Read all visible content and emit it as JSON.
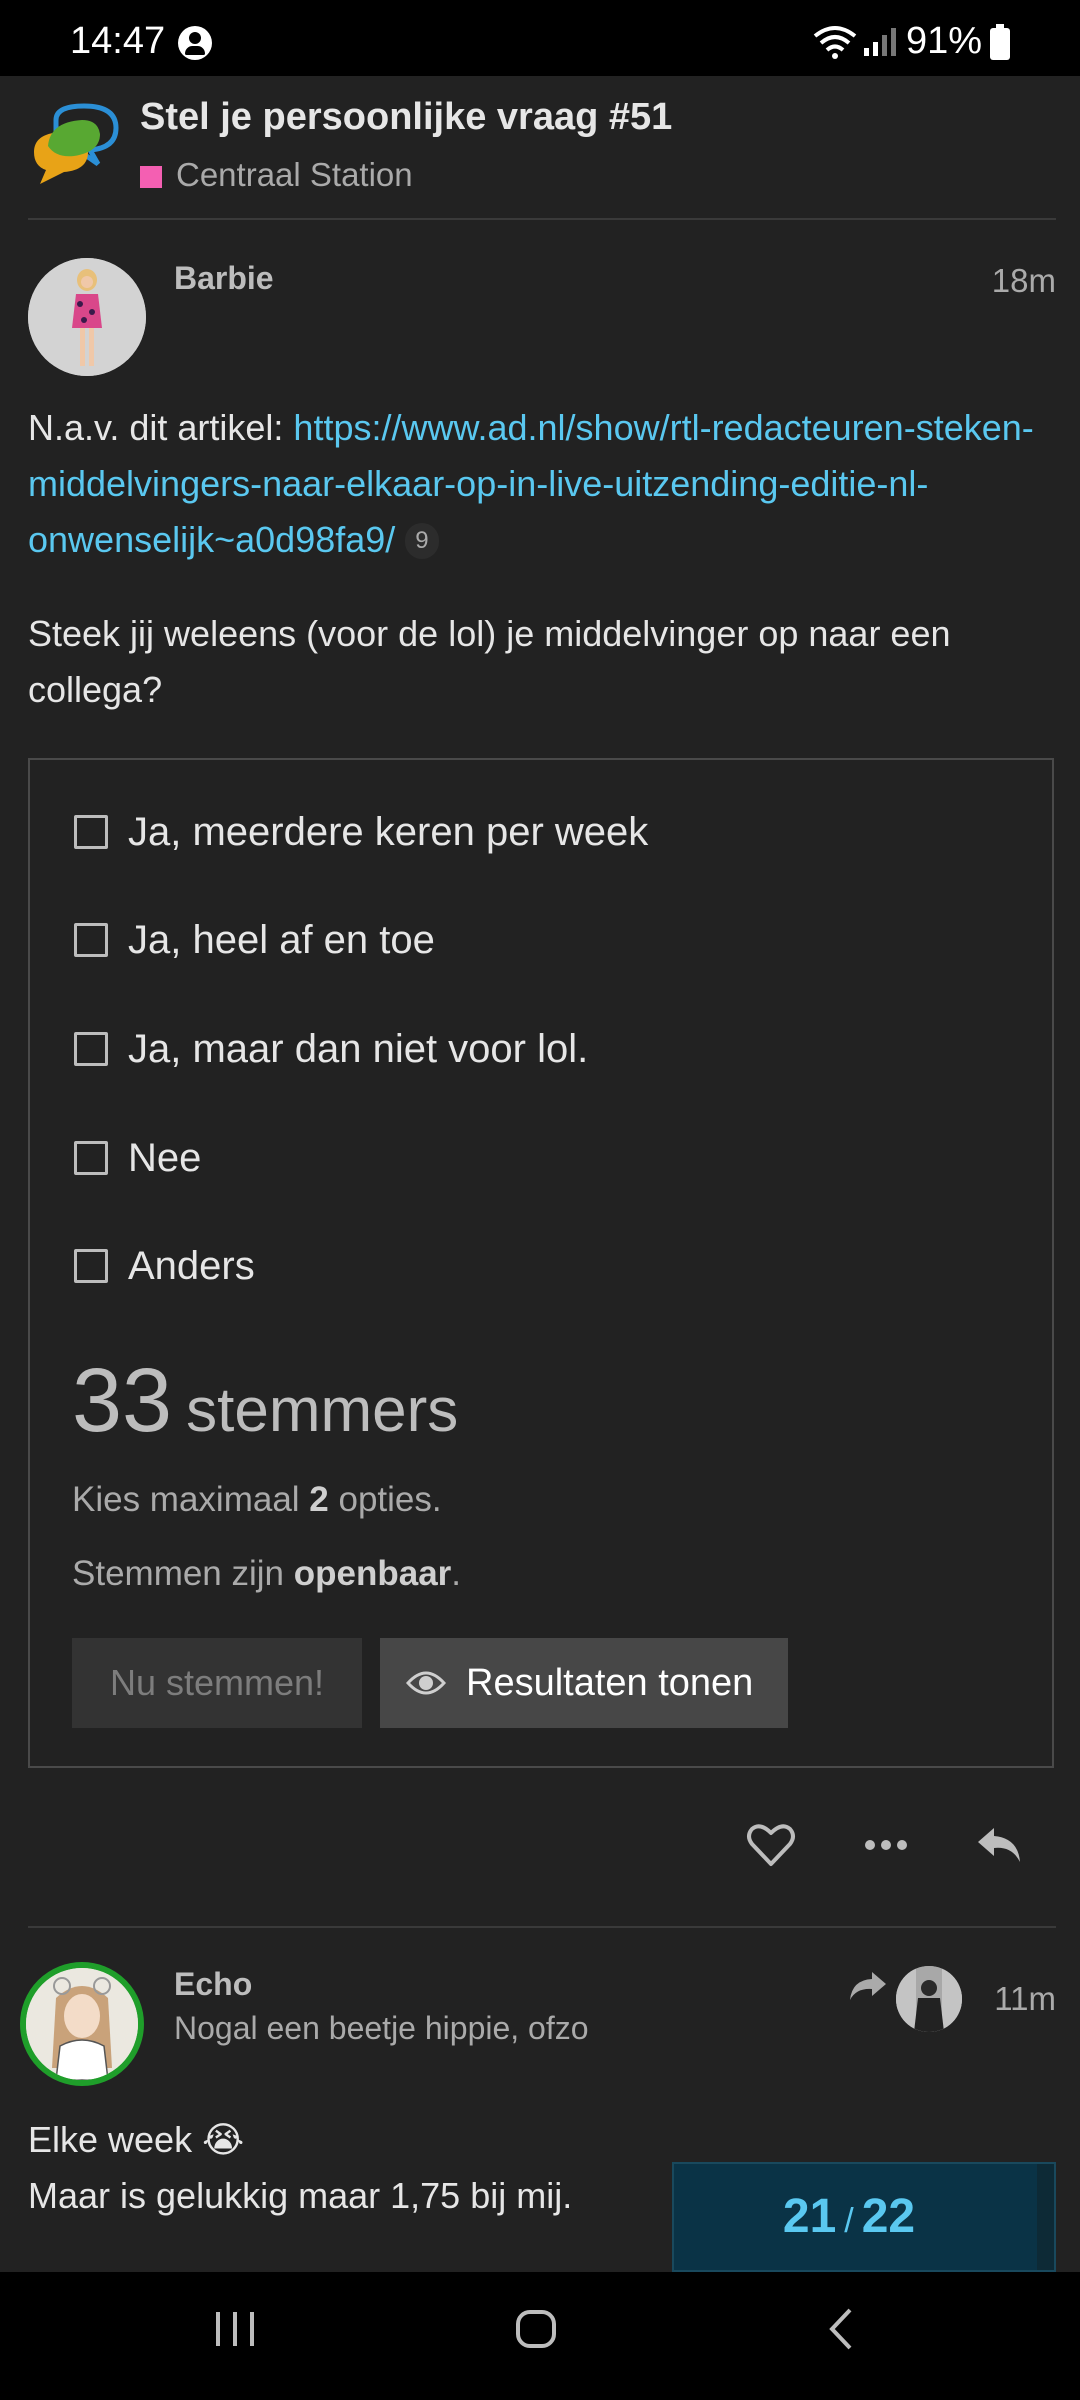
{
  "status_bar": {
    "time": "14:47",
    "battery": "91%"
  },
  "topic": {
    "title": "Stel je persoonlijke vraag #51",
    "category": "Centraal Station",
    "category_color": "#f45fb2"
  },
  "post1": {
    "username": "Barbie",
    "age": "18m",
    "intro": "N.a.v. dit artikel: ",
    "link_text": "https://www.ad.nl/show/rtl-redacteuren-steken-middelvingers-naar-elkaar-op-in-live-uitzending-editie-nl-onwenselijk~a0d98fa9/",
    "link_clicks": "9",
    "question": "Steek jij weleens (voor de lol) je middelvinger op naar een collega?"
  },
  "poll": {
    "options": [
      "Ja, meerdere keren per week",
      "Ja, heel af en toe",
      "Ja, maar dan niet voor lol.",
      "Nee",
      "Anders"
    ],
    "voters_count": "33",
    "voters_label": "stemmers",
    "max_text_pre": "Kies maximaal ",
    "max_value": "2",
    "max_text_post": " opties.",
    "public_text_pre": "Stemmen zijn ",
    "public_value": "openbaar",
    "public_text_post": ".",
    "vote_button": "Nu stemmen!",
    "results_button": "Resultaten tonen"
  },
  "post2": {
    "username": "Echo",
    "user_title": "Nogal een beetje hippie, ofzo",
    "age": "11m",
    "line1": "Elke week 😭",
    "line2": "Maar is gelukkig maar 1,75 bij mij."
  },
  "progress": {
    "current": "21",
    "separator": "/",
    "total": "22",
    "fraction": 0.9545
  },
  "colors": {
    "accent": "#5ac8f0",
    "background": "#222222",
    "flair_ring": "#1f9e2a"
  }
}
